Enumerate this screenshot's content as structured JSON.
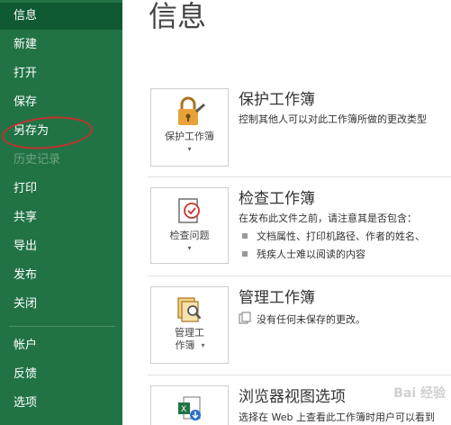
{
  "sidebar": {
    "items": [
      {
        "label": "信息"
      },
      {
        "label": "新建"
      },
      {
        "label": "打开"
      },
      {
        "label": "保存"
      },
      {
        "label": "另存为"
      },
      {
        "label": "历史记录"
      },
      {
        "label": "打印"
      },
      {
        "label": "共享"
      },
      {
        "label": "导出"
      },
      {
        "label": "发布"
      },
      {
        "label": "关闭"
      },
      {
        "label": "帐户"
      },
      {
        "label": "反馈"
      },
      {
        "label": "选项"
      }
    ]
  },
  "main": {
    "title": "信息",
    "protect": {
      "tile_label": "保护工作簿",
      "caret": "▾",
      "title": "保护工作簿",
      "description": "控制其他人可以对此工作簿所做的更改类型"
    },
    "inspect": {
      "tile_label": "检查问题",
      "caret": "▾",
      "title": "检查工作簿",
      "description": "在发布此文件之前，请注意其是否包含：",
      "bullets": [
        "文档属性、打印机路径、作者的姓名、",
        "残疾人士难以阅读的内容"
      ]
    },
    "manage": {
      "tile_label_1": "管理工",
      "tile_label_2": "作簿",
      "caret": "▾",
      "title": "管理工作簿",
      "description": "没有任何未保存的更改。"
    },
    "browser": {
      "title": "浏览器视图选项",
      "description": "选择在 Web 上查看此工作簿时用户可以看到"
    }
  },
  "watermark": "Bai 经验"
}
